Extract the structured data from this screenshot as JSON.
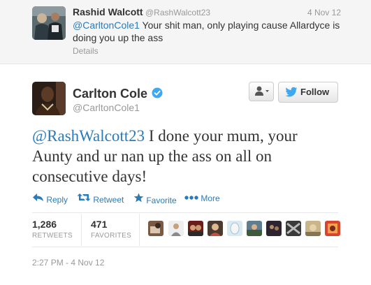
{
  "reply": {
    "name": "Rashid Walcott",
    "handle": "@RashWalcott23",
    "date": "4 Nov 12",
    "mention": "@CarltonCole1",
    "text": " Your shit man, only playing cause Allardyce is doing you up the ass",
    "details": "Details"
  },
  "tweet": {
    "name": "Carlton Cole",
    "handle": "@CarltonCole1",
    "mention": "@RashWalcott23",
    "text": " I done your mum, your Aunty and ur nan up the ass on all on consecutive days!",
    "follow_label": "Follow",
    "timestamp": "2:27 PM - 4 Nov 12"
  },
  "actions": {
    "reply": "Reply",
    "retweet": "Retweet",
    "favorite": "Favorite",
    "more": "More"
  },
  "stats": {
    "retweets_count": "1,286",
    "retweets_label": "RETWEETS",
    "favorites_count": "471",
    "favorites_label": "FAVORITES"
  },
  "icons": {
    "verified": "verified-badge-icon",
    "user_menu": "user-icon",
    "follow": "bird-icon",
    "reply": "reply-arrow-icon",
    "retweet": "retweet-icon",
    "favorite": "star-icon",
    "more": "more-dots-icon"
  },
  "colors": {
    "link": "#2b7bb9",
    "muted": "#999999",
    "reply_background": "#f5f5f5"
  }
}
